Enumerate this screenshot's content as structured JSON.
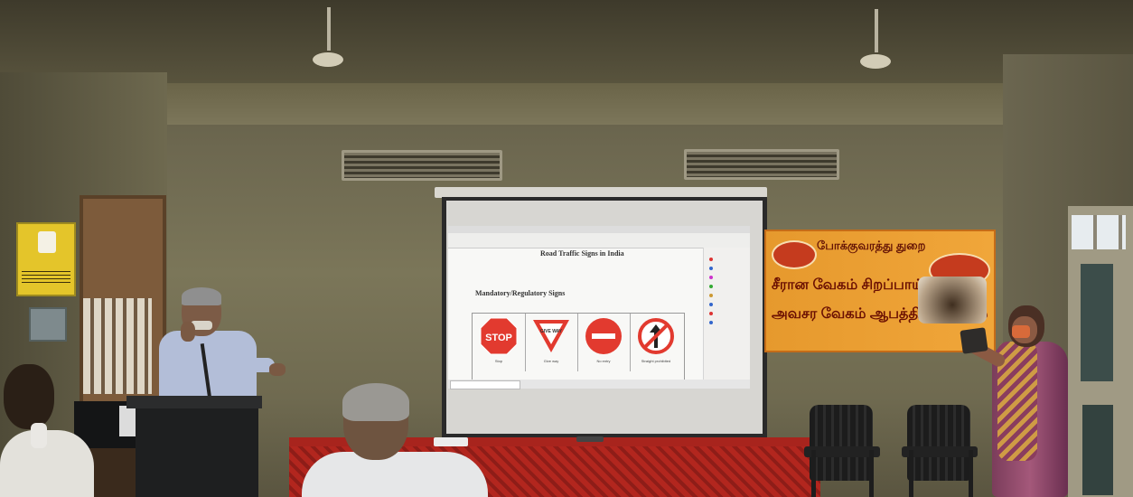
{
  "scene": {
    "description_type": "photo",
    "colors": {
      "table_cloth": "#a8241d",
      "banner": "#f0a63a",
      "wall": "#7b7659"
    }
  },
  "projector_slide": {
    "heading": "Road Traffic Signs in India",
    "subheading": "Mandatory/Regulatory Signs",
    "signs": [
      {
        "label": "Stop",
        "icon": "stop-sign-icon",
        "text": "STOP"
      },
      {
        "label": "Give way",
        "icon": "give-way-sign-icon",
        "text": "GIVE WAY"
      },
      {
        "label": "No entry",
        "icon": "no-entry-sign-icon"
      },
      {
        "label": "Straight prohibited",
        "icon": "straight-prohibited-sign-icon"
      }
    ]
  },
  "banner": {
    "title": "போக்குவரத்து துறை",
    "lines": [
      "சீரான வேகம் சிறப்பாய் முடியும்",
      "அவசர வேகம் ஆபத்தில் முடியும்"
    ]
  }
}
